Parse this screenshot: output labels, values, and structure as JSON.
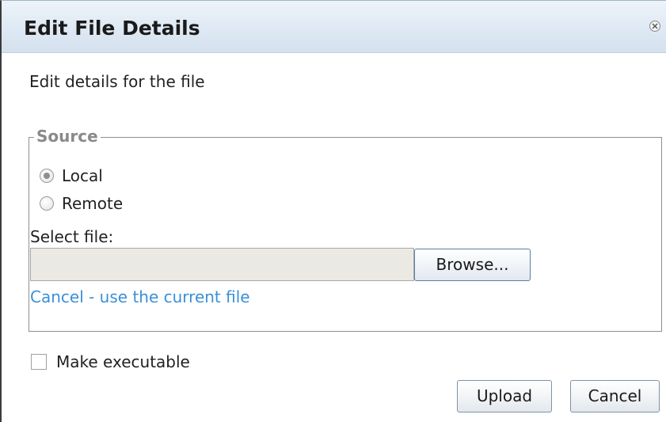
{
  "dialog": {
    "title": "Edit File Details",
    "close_icon": "close-circle-icon",
    "intro": "Edit details for the file"
  },
  "source": {
    "legend": "Source",
    "options": [
      {
        "label": "Local",
        "checked": true
      },
      {
        "label": "Remote",
        "checked": false
      }
    ],
    "select_file_label": "Select file:",
    "file_value": "",
    "browse_label": "Browse...",
    "cancel_link": "Cancel - use the current file"
  },
  "make_executable": {
    "label": "Make executable",
    "checked": false
  },
  "buttons": {
    "upload": "Upload",
    "cancel": "Cancel"
  },
  "colors": {
    "titlebar": "#dfe9f4",
    "link": "#3b8fd8",
    "legend": "#8a8a8a",
    "file_input_bg": "#ebe9e4"
  }
}
